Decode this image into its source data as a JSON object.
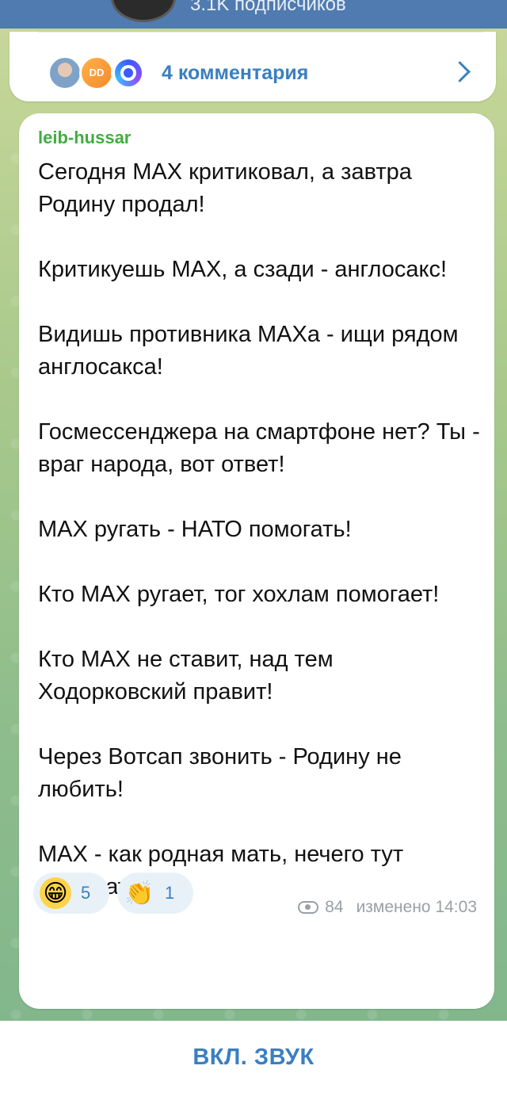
{
  "header": {
    "subscribers_text": "3.1K подписчиков"
  },
  "comments_bar": {
    "avatar_badge": "DD",
    "label": "4 комментария"
  },
  "message": {
    "author": "leib-hussar",
    "paragraphs": [
      "Сегодня MAX критиковал, а завтра Родину продал!",
      "Критикуешь MAX, а сзади - англосакс!",
      "Видишь противника MAXа - ищи рядом англосакса!",
      "Госмессенджера на смартфоне нет? Ты - враг народа, вот ответ!",
      "MAX ругать - НАТО помогать!",
      "Кто MAX ругает, тог хохлам помогает!",
      "Кто MAX не ставит, над тем Ходорковский правит!",
      "Через Вотсап звонить - Родину не любить!",
      "MAX - как родная мать, нечего тут выбирать!"
    ],
    "reactions": [
      {
        "emoji": "😁",
        "count": "5"
      },
      {
        "emoji": "👏",
        "count": "1"
      }
    ],
    "views": "84",
    "edited_time": "изменено 14:03"
  },
  "bottom": {
    "sound_button": "ВКЛ. ЗВУК"
  },
  "colors": {
    "accent": "#3a7fc1",
    "author": "#3fae3f",
    "top_bar": "#4f7bb0"
  }
}
